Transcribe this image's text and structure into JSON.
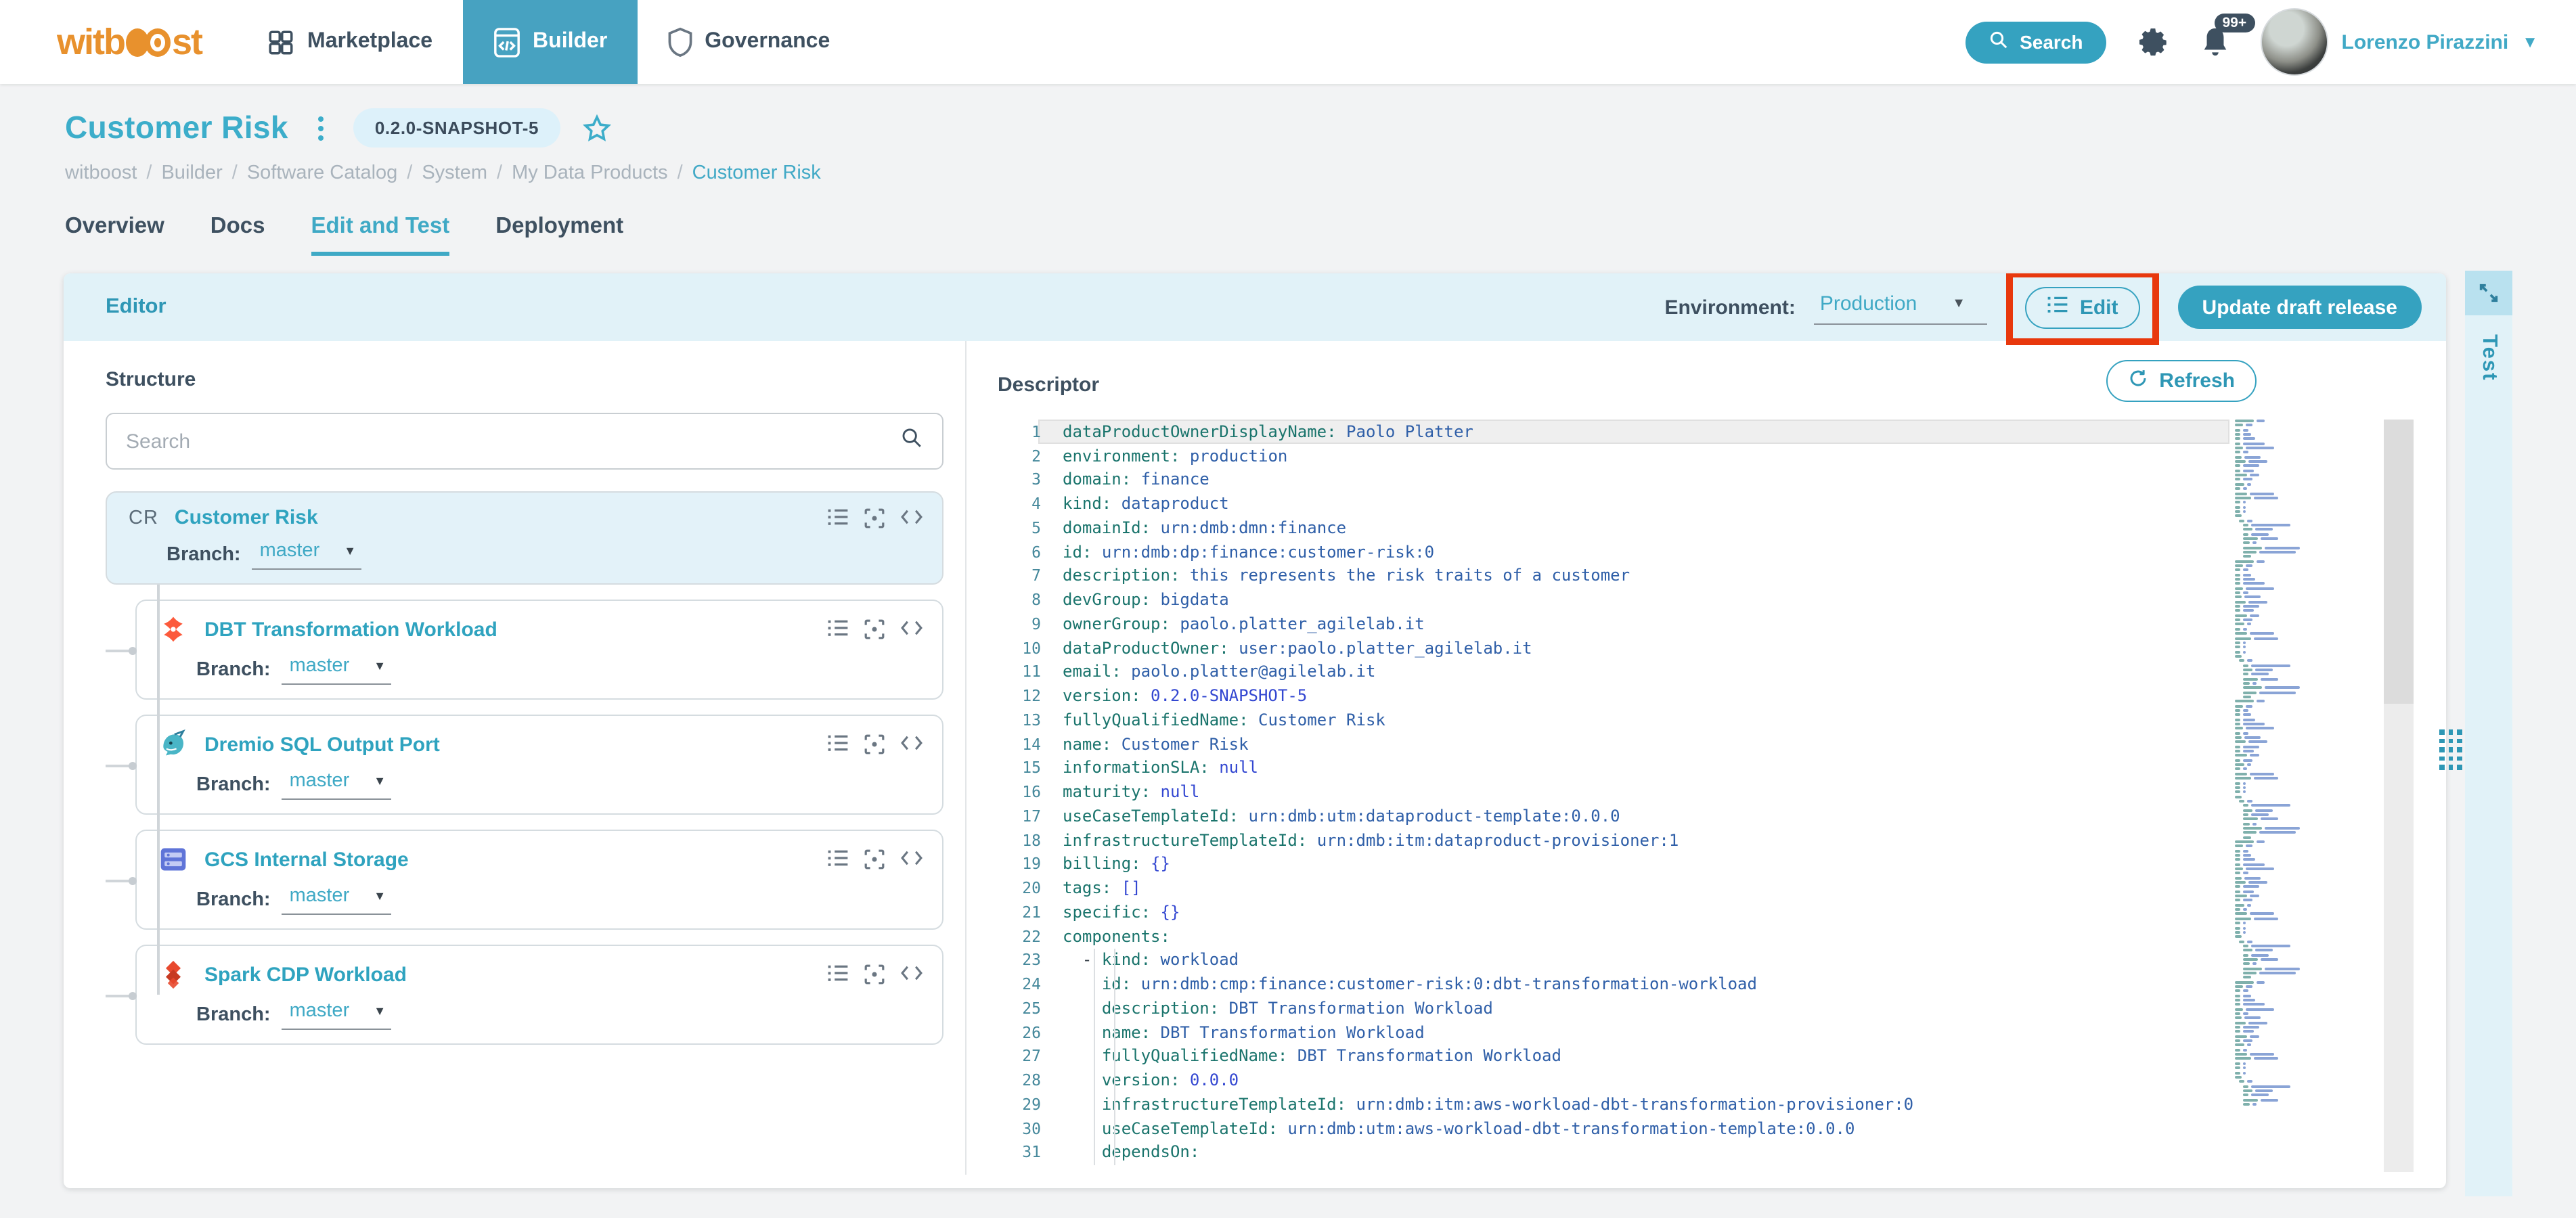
{
  "nav": {
    "brand": "witboost",
    "items": [
      {
        "label": "Marketplace",
        "icon": "grid-icon",
        "active": false
      },
      {
        "label": "Builder",
        "icon": "code-window-icon",
        "active": true
      },
      {
        "label": "Governance",
        "icon": "shield-icon",
        "active": false
      }
    ],
    "search_label": "Search",
    "notifications_badge": "99+",
    "user_name": "Lorenzo Pirazzini"
  },
  "header": {
    "title": "Customer Risk",
    "version_badge": "0.2.0-SNAPSHOT-5",
    "breadcrumb": [
      "witboost",
      "Builder",
      "Software Catalog",
      "System",
      "My Data Products",
      "Customer Risk"
    ],
    "tabs": [
      {
        "label": "Overview",
        "active": false
      },
      {
        "label": "Docs",
        "active": false
      },
      {
        "label": "Edit and Test",
        "active": true
      },
      {
        "label": "Deployment",
        "active": false
      }
    ]
  },
  "editor": {
    "panel_title": "Editor",
    "environment_label": "Environment:",
    "environment_value": "Production",
    "edit_button_label": "Edit",
    "update_button_label": "Update draft release",
    "test_tab_label": "Test"
  },
  "structure": {
    "title": "Structure",
    "search_placeholder": "Search",
    "branch_label": "Branch:",
    "root": {
      "initials": "CR",
      "name": "Customer Risk",
      "branch": "master"
    },
    "children": [
      {
        "name": "DBT Transformation Workload",
        "branch": "master",
        "icon": "dbt-icon"
      },
      {
        "name": "Dremio SQL Output Port",
        "branch": "master",
        "icon": "dremio-icon"
      },
      {
        "name": "GCS Internal Storage",
        "branch": "master",
        "icon": "gcs-icon"
      },
      {
        "name": "Spark CDP Workload",
        "branch": "master",
        "icon": "spark-cdp-icon"
      }
    ]
  },
  "descriptor": {
    "title": "Descriptor",
    "refresh_button_label": "Refresh",
    "code_lines": [
      "dataProductOwnerDisplayName: Paolo Platter",
      "environment: production",
      "domain: finance",
      "kind: dataproduct",
      "domainId: urn:dmb:dmn:finance",
      "id: urn:dmb:dp:finance:customer-risk:0",
      "description: this represents the risk traits of a customer",
      "devGroup: bigdata",
      "ownerGroup: paolo.platter_agilelab.it",
      "dataProductOwner: user:paolo.platter_agilelab.it",
      "email: paolo.platter@agilelab.it",
      "version: 0.2.0-SNAPSHOT-5",
      "fullyQualifiedName: Customer Risk",
      "name: Customer Risk",
      "informationSLA: null",
      "maturity: null",
      "useCaseTemplateId: urn:dmb:utm:dataproduct-template:0.0.0",
      "infrastructureTemplateId: urn:dmb:itm:dataproduct-provisioner:1",
      "billing: {}",
      "tags: []",
      "specific: {}",
      "components:",
      "  - kind: workload",
      "    id: urn:dmb:cmp:finance:customer-risk:0:dbt-transformation-workload",
      "    description: DBT Transformation Workload",
      "    name: DBT Transformation Workload",
      "    fullyQualifiedName: DBT Transformation Workload",
      "    version: 0.0.0",
      "    infrastructureTemplateId: urn:dmb:itm:aws-workload-dbt-transformation-provisioner:0",
      "    useCaseTemplateId: urn:dmb:utm:aws-workload-dbt-transformation-template:0.0.0",
      "    dependsOn:"
    ]
  },
  "colors": {
    "accent_teal": "#35a2c0",
    "link_teal": "#3fa9c5",
    "title_teal": "#3cadca",
    "brand_orange": "#e8912d",
    "dark_slate": "#3e5060",
    "editor_bar_blue": "#e1f2f8",
    "annotation_red": "#e8380d",
    "code_key": "#1a746c",
    "code_value": "#2f5fa8"
  }
}
